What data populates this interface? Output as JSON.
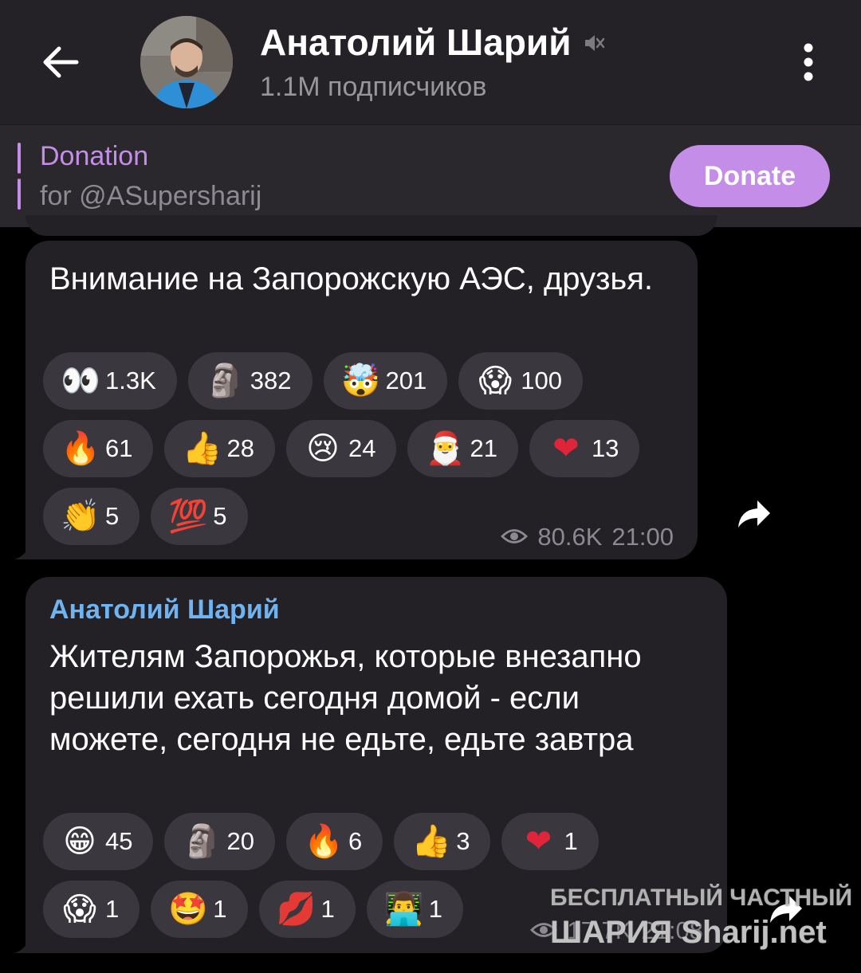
{
  "header": {
    "channel_name": "Анатолий Шарий",
    "subscribers": "1.1M подписчиков",
    "muted_icon": "speaker-muted-icon"
  },
  "pinned": {
    "title": "Donation",
    "subtitle": "for @ASupersharij",
    "button": "Donate"
  },
  "colors": {
    "accent": "#c48ee8",
    "author": "#6fb4f0",
    "bubble": "#232126",
    "reaction_bg": "#3b373e"
  },
  "messages": [
    {
      "text": "Внимание на Запорожскую АЭС, друзья.",
      "reactions": [
        {
          "emoji": "👀",
          "icon": "eyes-icon",
          "count": "1.3K"
        },
        {
          "emoji": "🗿",
          "icon": "moai-icon",
          "count": "382"
        },
        {
          "emoji": "🤯",
          "icon": "exploding-head-icon",
          "count": "201"
        },
        {
          "emoji": "😱",
          "icon": "scream-icon",
          "count": "100"
        },
        {
          "emoji": "🔥",
          "icon": "fire-icon",
          "count": "61"
        },
        {
          "emoji": "👍",
          "icon": "thumbs-up-icon",
          "count": "28"
        },
        {
          "emoji": "😢",
          "icon": "crying-face-icon",
          "count": "24"
        },
        {
          "emoji": "🎅",
          "icon": "santa-icon",
          "count": "21"
        },
        {
          "emoji": "❤",
          "icon": "heart-icon",
          "count": "13"
        },
        {
          "emoji": "👏",
          "icon": "clapping-hands-icon",
          "count": "5"
        },
        {
          "emoji": "💯",
          "icon": "hundred-points-icon",
          "count": "5"
        }
      ],
      "views": "80.6K",
      "time": "21:00"
    },
    {
      "author": "Анатолий Шарий",
      "text": "Жителям Запорожья, которые внезапно решили ехать сегодня домой - если можете, сегодня не едьте, едьте завтра",
      "reactions": [
        {
          "emoji": "😁",
          "icon": "grinning-face-icon",
          "count": "45"
        },
        {
          "emoji": "🗿",
          "icon": "moai-icon",
          "count": "20"
        },
        {
          "emoji": "🔥",
          "icon": "fire-icon",
          "count": "6"
        },
        {
          "emoji": "👍",
          "icon": "thumbs-up-icon",
          "count": "3"
        },
        {
          "emoji": "❤",
          "icon": "heart-icon",
          "count": "1"
        },
        {
          "emoji": "😱",
          "icon": "scream-icon",
          "count": "1"
        },
        {
          "emoji": "🤩",
          "icon": "star-struck-icon",
          "count": "1"
        },
        {
          "emoji": "💋",
          "icon": "kiss-mark-icon",
          "count": "1"
        },
        {
          "emoji": "👨‍💻",
          "icon": "technologist-icon",
          "count": "1"
        }
      ],
      "views": "17.7K",
      "time": "21:08"
    }
  ],
  "watermark": {
    "line1": "БЕСПЛАТНЫЙ ЧАСТНЫЙ",
    "line2": "ШАРИЯ Sharij.net"
  }
}
